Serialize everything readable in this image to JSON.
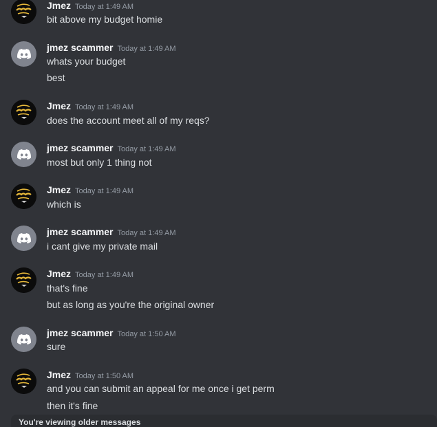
{
  "messages": [
    {
      "user": "Jmez",
      "time": "Today at 1:49 AM",
      "avatar": "jmez-logo",
      "lines": [
        "bit above my budget homie"
      ]
    },
    {
      "user": "jmez scammer",
      "time": "Today at 1:49 AM",
      "avatar": "discord-default",
      "lines": [
        "whats your budget",
        "best"
      ]
    },
    {
      "user": "Jmez",
      "time": "Today at 1:49 AM",
      "avatar": "jmez-logo",
      "lines": [
        "does the account meet all of my reqs?"
      ]
    },
    {
      "user": "jmez scammer",
      "time": "Today at 1:49 AM",
      "avatar": "discord-default",
      "lines": [
        "most but only 1 thing not"
      ]
    },
    {
      "user": "Jmez",
      "time": "Today at 1:49 AM",
      "avatar": "jmez-logo",
      "lines": [
        "which is"
      ]
    },
    {
      "user": "jmez scammer",
      "time": "Today at 1:49 AM",
      "avatar": "discord-default",
      "lines": [
        "i cant give my private mail"
      ]
    },
    {
      "user": "Jmez",
      "time": "Today at 1:49 AM",
      "avatar": "jmez-logo",
      "lines": [
        "that's fine",
        "but as long as you're the original owner"
      ]
    },
    {
      "user": "jmez scammer",
      "time": "Today at 1:50 AM",
      "avatar": "discord-default",
      "lines": [
        "sure"
      ]
    },
    {
      "user": "Jmez",
      "time": "Today at 1:50 AM",
      "avatar": "jmez-logo",
      "lines": [
        "and you can submit an appeal for me once i get perm",
        "then it's fine"
      ]
    }
  ],
  "older_bar": {
    "text": "You're viewing older messages"
  },
  "colors": {
    "background": "#313338",
    "username": "#f2f3f5",
    "timestamp": "#949ba4",
    "text": "#dbdee1",
    "discord_avatar": "#80848e",
    "logo_gold": "#e8b93a"
  }
}
